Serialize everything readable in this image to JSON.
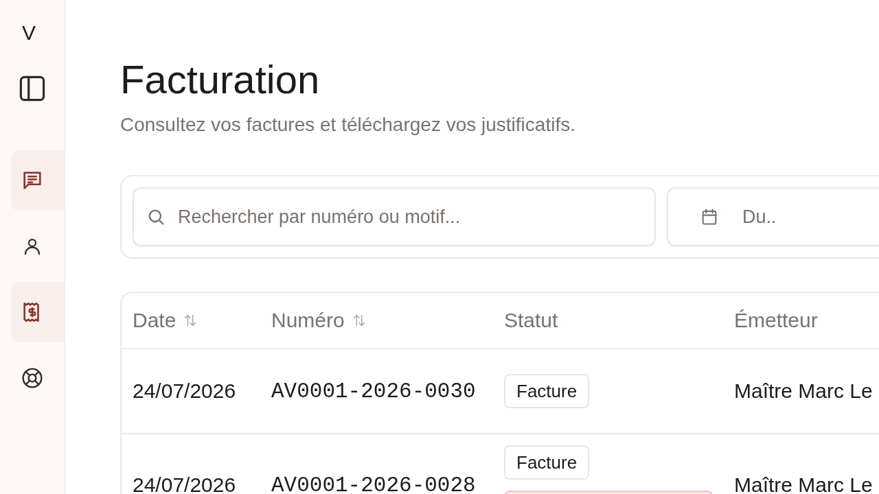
{
  "sidebar": {
    "logo": "V",
    "items": [
      {
        "kind": "messages",
        "selected": true
      },
      {
        "kind": "user",
        "selected": false
      },
      {
        "kind": "billing",
        "selected": true
      },
      {
        "kind": "help",
        "selected": false
      }
    ]
  },
  "header": {
    "title": "Facturation",
    "subtitle": "Consultez vos factures et téléchargez vos justificatifs."
  },
  "filters": {
    "search": {
      "placeholder": "Rechercher par numéro ou motif..."
    },
    "date": {
      "placeholder": "Du.."
    }
  },
  "table": {
    "columns": [
      {
        "label": "Date",
        "sortable": true
      },
      {
        "label": "Numéro",
        "sortable": true
      },
      {
        "label": "Statut",
        "sortable": false
      },
      {
        "label": "Émetteur",
        "sortable": false
      }
    ],
    "rows": [
      {
        "date": "24/07/2026",
        "number": "AV0001-2026-0030",
        "statuses": [
          {
            "kind": "neutral",
            "label": "Facture"
          }
        ],
        "issuer": "Maître Marc Le"
      },
      {
        "date": "24/07/2026",
        "number": "AV0001-2026-0028",
        "statuses": [
          {
            "kind": "neutral",
            "label": "Facture"
          },
          {
            "kind": "alert"
          }
        ],
        "issuer": "Maître Marc Le"
      }
    ]
  }
}
